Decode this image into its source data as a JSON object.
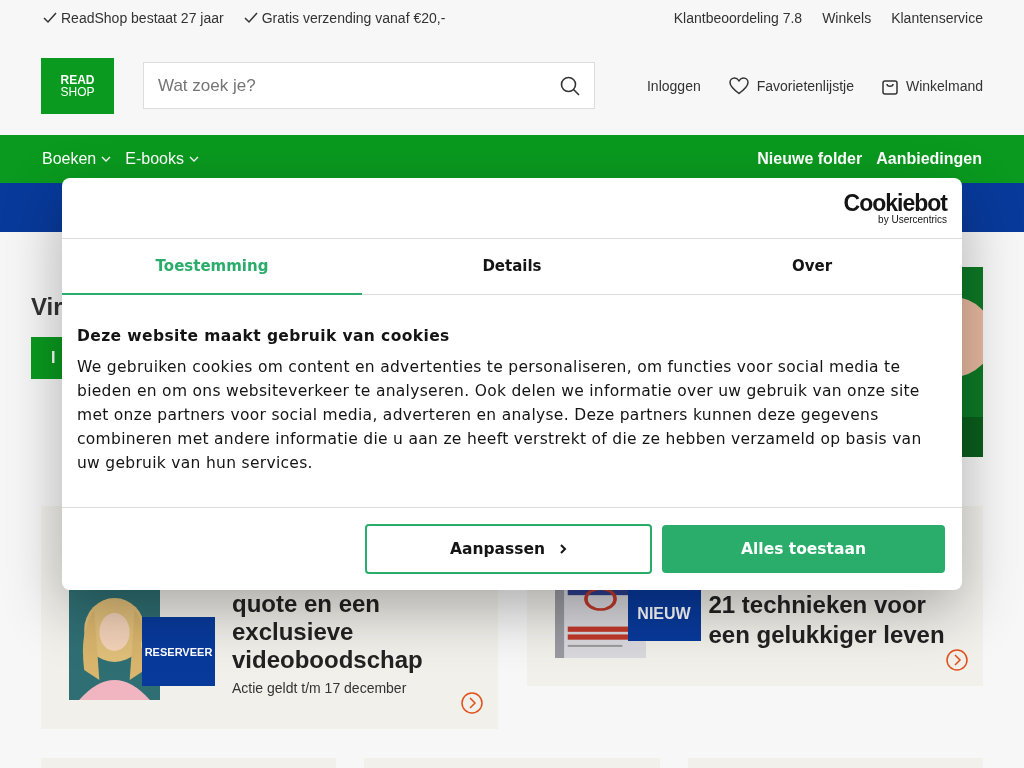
{
  "top_bar": {
    "usps": [
      "ReadShop bestaat 27 jaar",
      "Gratis verzending vanaf €20,-"
    ],
    "links": [
      "Klantbeoordeling 7.8",
      "Winkels",
      "Klantenservice"
    ]
  },
  "header": {
    "logo": [
      "READ",
      "SHOP"
    ],
    "search": {
      "placeholder": "Wat zoek je?"
    },
    "actions": [
      {
        "kind": "login",
        "label": "Inloggen"
      },
      {
        "kind": "wishlist",
        "label": "Favorietenlijstje"
      },
      {
        "kind": "cart",
        "label": "Winkelmand"
      }
    ]
  },
  "nav": {
    "menus": [
      "Boeken",
      "E-books"
    ],
    "links": [
      "Nieuwe folder",
      "Aanbiedingen"
    ]
  },
  "hero": {
    "heading": "Vir",
    "button": "I"
  },
  "promos": [
    {
      "badge": "RESERVEER",
      "title": "quote en een exclusieve videoboodschap",
      "note": "Actie geldt t/m 17 december"
    },
    {
      "badge": "NIEUW",
      "title": "21 technieken voor een gelukkiger leven"
    }
  ],
  "cookie_dialog": {
    "brand": "Cookiebot",
    "brand_sub": "by Usercentrics",
    "tabs": [
      {
        "label": "Toestemming",
        "selected": true
      },
      {
        "label": "Details",
        "selected": false
      },
      {
        "label": "Over",
        "selected": false
      }
    ],
    "title": "Deze website maakt gebruik van cookies",
    "text": "We gebruiken cookies om content en advertenties te personaliseren, om functies voor social media te bieden en om ons websiteverkeer te analyseren. Ook delen we informatie over uw gebruik van onze site met onze partners voor social media, adverteren en analyse. Deze partners kunnen deze gegevens combineren met andere informatie die u aan ze heeft verstrekt of die ze hebben verzameld op basis van uw gebruik van hun services.",
    "buttons": [
      {
        "kind": "secondary",
        "label": "Aanpassen"
      },
      {
        "kind": "primary",
        "label": "Alles toestaan"
      }
    ]
  }
}
